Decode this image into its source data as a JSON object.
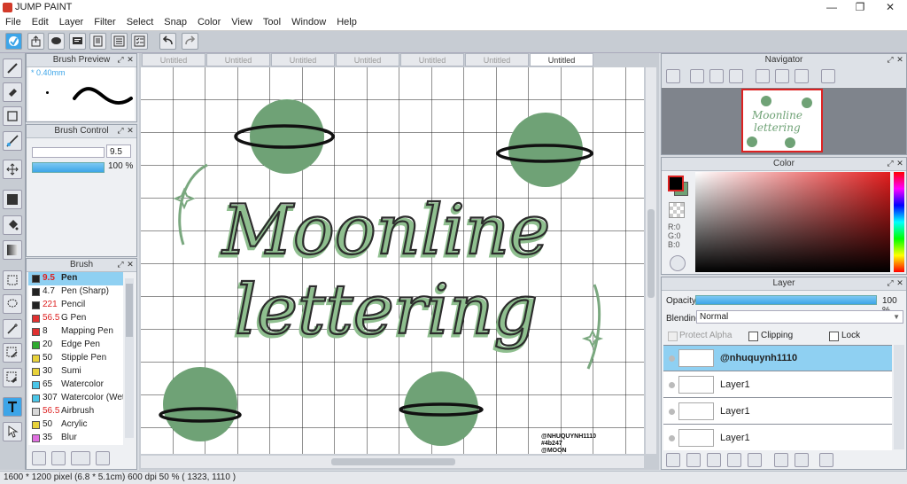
{
  "app": {
    "title": "JUMP PAINT"
  },
  "window_controls": {
    "minimize": "—",
    "restore": "❐",
    "close": "✕"
  },
  "menu": [
    "File",
    "Edit",
    "Layer",
    "Filter",
    "Select",
    "Snap",
    "Color",
    "View",
    "Tool",
    "Window",
    "Help"
  ],
  "tabs": [
    {
      "label": "Untitled",
      "active": false
    },
    {
      "label": "Untitled",
      "active": false
    },
    {
      "label": "Untitled",
      "active": false
    },
    {
      "label": "Untitled",
      "active": false
    },
    {
      "label": "Untitled",
      "active": false
    },
    {
      "label": "Untitled",
      "active": false
    },
    {
      "label": "Untitled",
      "active": true
    }
  ],
  "brush_preview": {
    "title": "Brush Preview",
    "size_label": "* 0.40mm"
  },
  "brush_control": {
    "title": "Brush Control",
    "size_value": "9.5",
    "opacity_value": "100 %"
  },
  "brush_panel": {
    "title": "Brush",
    "items": [
      {
        "size": "9.5",
        "name": "Pen",
        "color": "#222222",
        "size_color": "#d22",
        "selected": true
      },
      {
        "size": "4.7",
        "name": "Pen (Sharp)",
        "color": "#222222",
        "size_color": "#222",
        "selected": false
      },
      {
        "size": "221",
        "name": "Pencil",
        "color": "#222222",
        "size_color": "#d22",
        "selected": false
      },
      {
        "size": "56.5",
        "name": "G Pen",
        "color": "#e03030",
        "size_color": "#d22",
        "selected": false
      },
      {
        "size": "8",
        "name": "Mapping Pen",
        "color": "#e03030",
        "size_color": "#222",
        "selected": false
      },
      {
        "size": "20",
        "name": "Edge Pen",
        "color": "#2faa2f",
        "size_color": "#222",
        "selected": false
      },
      {
        "size": "50",
        "name": "Stipple Pen",
        "color": "#e8d23a",
        "size_color": "#222",
        "selected": false
      },
      {
        "size": "30",
        "name": "Sumi",
        "color": "#e8d23a",
        "size_color": "#222",
        "selected": false
      },
      {
        "size": "65",
        "name": "Watercolor",
        "color": "#4ac6e8",
        "size_color": "#222",
        "selected": false
      },
      {
        "size": "307",
        "name": "Watercolor (Wet)",
        "color": "#4ac6e8",
        "size_color": "#222",
        "selected": false
      },
      {
        "size": "56.5",
        "name": "Airbrush",
        "color": "#d8d8d8",
        "size_color": "#d22",
        "selected": false
      },
      {
        "size": "50",
        "name": "Acrylic",
        "color": "#e8d23a",
        "size_color": "#222",
        "selected": false
      },
      {
        "size": "35",
        "name": "Blur",
        "color": "#e070e0",
        "size_color": "#222",
        "selected": false
      }
    ]
  },
  "canvas": {
    "text_line1": "Moonline",
    "text_line2": "lettering",
    "watermark": [
      "@NHUQUYNH1110",
      "#4b247",
      "@MOON"
    ]
  },
  "navigator": {
    "title": "Navigator",
    "thumb_line1": "Moonline",
    "thumb_line2": "lettering"
  },
  "color_panel": {
    "title": "Color",
    "r": "R:0",
    "g": "G:0",
    "b": "B:0",
    "accent": "#000000"
  },
  "layer_panel": {
    "title": "Layer",
    "opacity_label": "Opacity",
    "opacity_value": "100 %",
    "opacity": 1.0,
    "blending_label": "Blending",
    "blending_value": "Normal",
    "protect_alpha": "Protect Alpha",
    "clipping": "Clipping",
    "lock": "Lock",
    "layers": [
      {
        "name": "@nhuquynh1110",
        "selected": true
      },
      {
        "name": "Layer1",
        "selected": false
      },
      {
        "name": "Layer1",
        "selected": false
      },
      {
        "name": "Layer1",
        "selected": false
      }
    ]
  },
  "status": {
    "text": "1600 * 1200 pixel   (6.8 * 5.1cm)   600 dpi   50 %   ( 1323, 1110 )"
  },
  "colors": {
    "accent": "#3da5e8",
    "selection": "#8fd0f2",
    "planet": "#6fa276",
    "letter": "#2c2c2c",
    "letter_shadow": "#8fbf8f"
  }
}
